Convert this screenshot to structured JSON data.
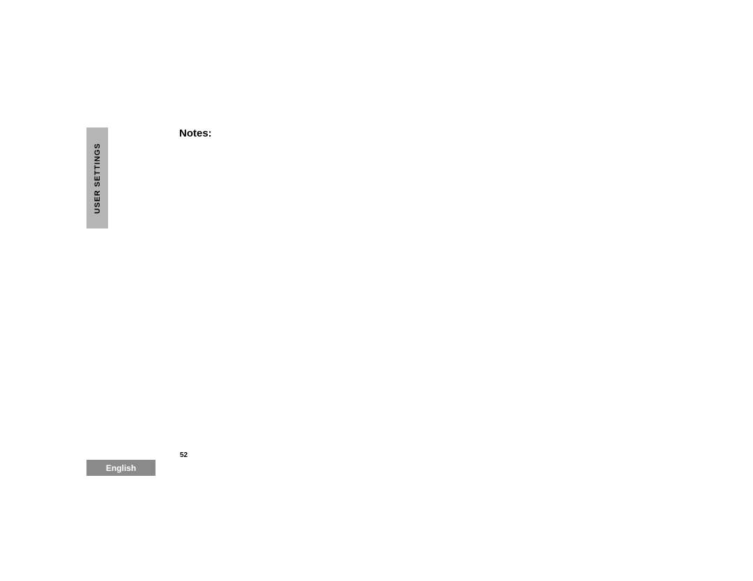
{
  "sidebar": {
    "section_label": "User Settings"
  },
  "main": {
    "heading": "Notes:"
  },
  "footer": {
    "page_number": "52",
    "language": "English"
  }
}
